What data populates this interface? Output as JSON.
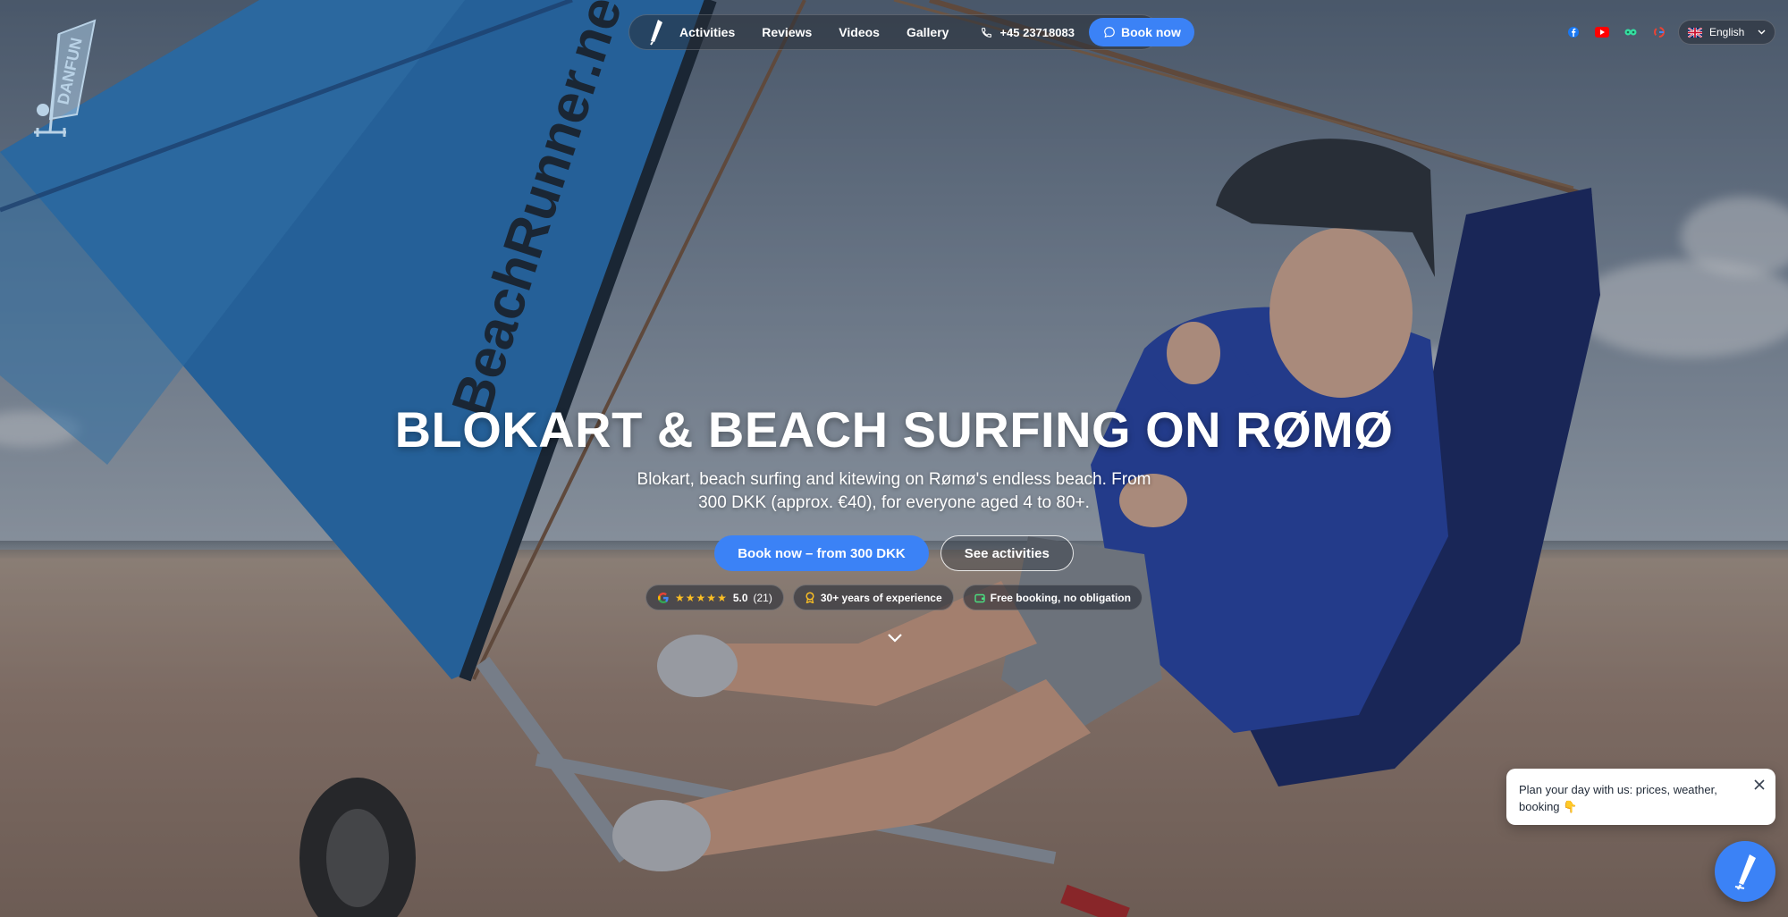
{
  "brand": {
    "logo_icon": "danfun-kitewing-logo",
    "logo_text": "DANFUN"
  },
  "nav": {
    "links": [
      "Activities",
      "Reviews",
      "Videos",
      "Gallery"
    ],
    "phone": "+45 23718083",
    "book_label": "Book now"
  },
  "socials": [
    {
      "name": "facebook-icon",
      "color": "#1877f2"
    },
    {
      "name": "youtube-icon",
      "color": "#ff0000"
    },
    {
      "name": "tripadvisor-icon",
      "color": "#34e0a1"
    },
    {
      "name": "google-icon",
      "color": "#ea4335"
    }
  ],
  "language": {
    "flag_icon": "uk-flag-icon",
    "label": "English"
  },
  "hero": {
    "title": "BLOKART & BEACH SURFING ON RØMØ",
    "subtitle": "Blokart, beach surfing and kitewing on Rømø's endless beach. From 300 DKK (approx. €40), for everyone aged 4 to 80+.",
    "primary_cta": "Book now – from 300 DKK",
    "secondary_cta": "See activities",
    "badges": {
      "rating_stars": "★★★★★",
      "rating_value": "5.0",
      "rating_count": "(21)",
      "experience": "30+ years of experience",
      "free_booking": "Free booking, no obligation"
    },
    "sail_text": "BeachRunner.net"
  },
  "chat": {
    "message": "Plan your day with us: prices, weather, booking 👇"
  },
  "colors": {
    "accent": "#3b82f6",
    "star": "#fbbf24"
  }
}
